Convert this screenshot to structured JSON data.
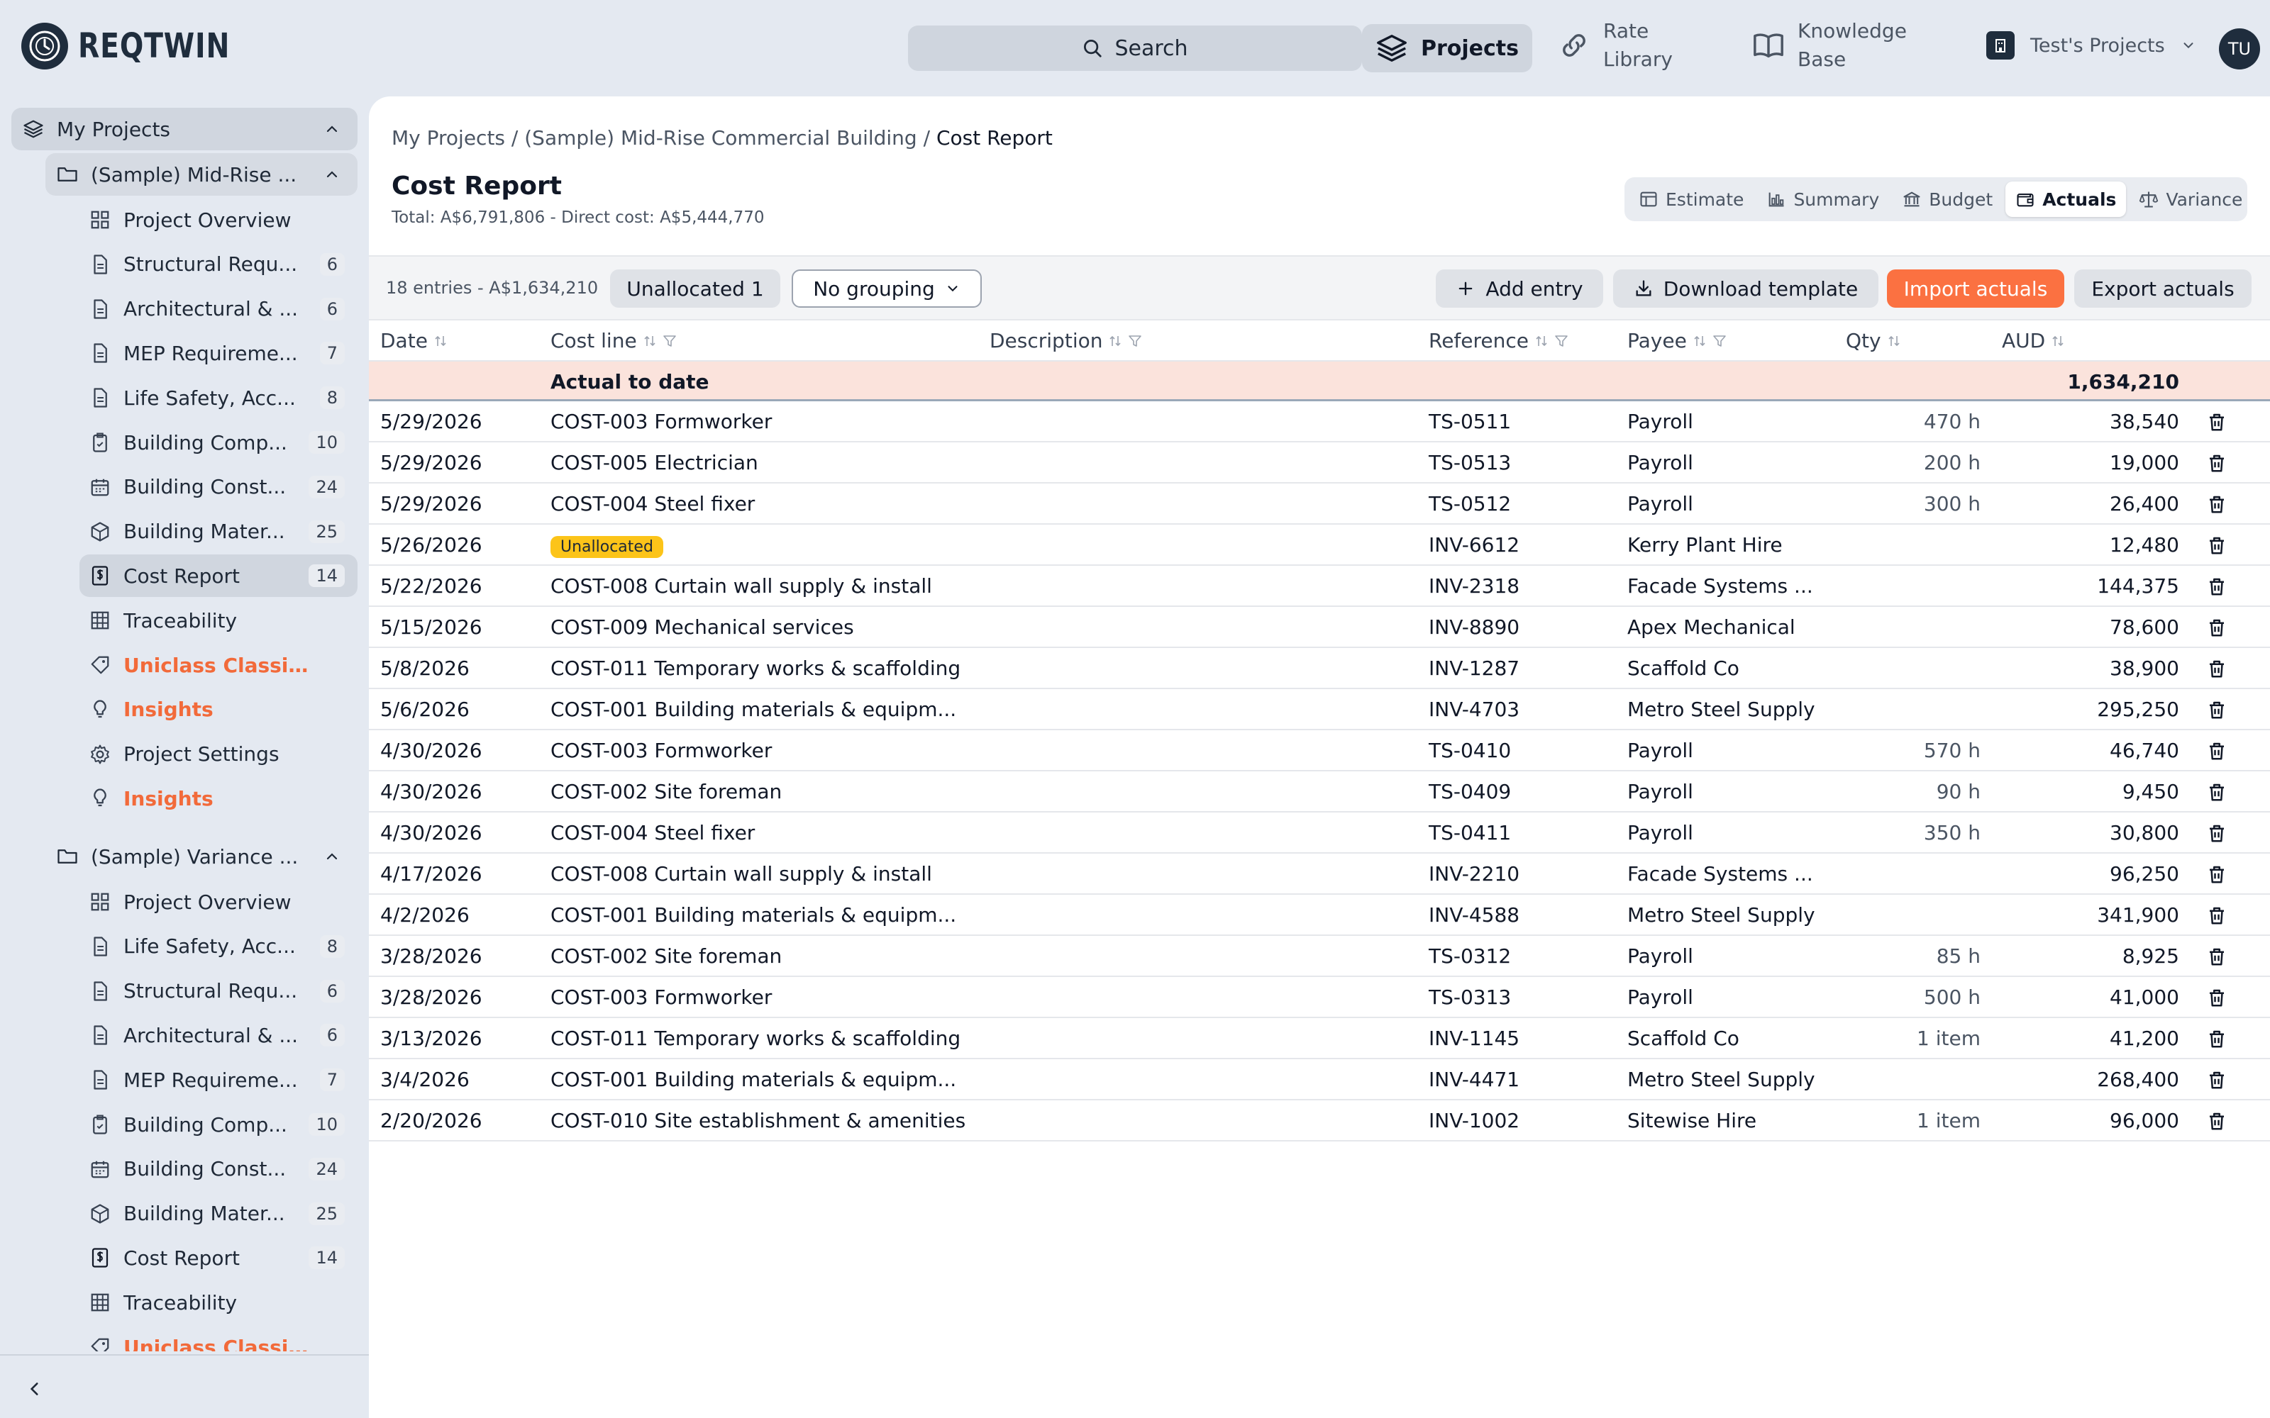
{
  "brand": {
    "name": "REQTWIN"
  },
  "topnav": {
    "search_label": "Search",
    "projects_label": "Projects",
    "rate_line1": "Rate",
    "rate_line2": "Library",
    "kb_line1": "Knowledge",
    "kb_line2": "Base",
    "org_label": "Test's Projects",
    "avatar_initials": "TU"
  },
  "sidebar": {
    "root_label": "My Projects",
    "project1": {
      "label": "(Sample) Mid-Rise ...",
      "items": [
        {
          "label": "Project Overview",
          "icon": "grid-icon",
          "count": ""
        },
        {
          "label": "Structural Requ...",
          "icon": "document-icon",
          "count": "6"
        },
        {
          "label": "Architectural & ...",
          "icon": "document-icon",
          "count": "6"
        },
        {
          "label": "MEP Requireme...",
          "icon": "document-icon",
          "count": "7"
        },
        {
          "label": "Life Safety, Acc...",
          "icon": "document-icon",
          "count": "8"
        },
        {
          "label": "Building Comp...",
          "icon": "clipboard-icon",
          "count": "10"
        },
        {
          "label": "Building Const...",
          "icon": "calendar-icon",
          "count": "24"
        },
        {
          "label": "Building Mater...",
          "icon": "box-icon",
          "count": "25"
        },
        {
          "label": "Cost Report",
          "icon": "dollar-doc-icon",
          "count": "14"
        },
        {
          "label": "Traceability",
          "icon": "table-icon",
          "count": ""
        },
        {
          "label": "Uniclass Classific...",
          "icon": "tag-icon",
          "count": ""
        },
        {
          "label": "Insights",
          "icon": "bulb-icon",
          "count": ""
        },
        {
          "label": "Project Settings",
          "icon": "gear-icon",
          "count": ""
        },
        {
          "label": "Insights",
          "icon": "bulb-icon",
          "count": ""
        }
      ]
    },
    "project2": {
      "label": "(Sample) Variance ...",
      "items": [
        {
          "label": "Project Overview",
          "icon": "grid-icon",
          "count": ""
        },
        {
          "label": "Life Safety, Acc...",
          "icon": "document-icon",
          "count": "8"
        },
        {
          "label": "Structural Requ...",
          "icon": "document-icon",
          "count": "6"
        },
        {
          "label": "Architectural & ...",
          "icon": "document-icon",
          "count": "6"
        },
        {
          "label": "MEP Requireme...",
          "icon": "document-icon",
          "count": "7"
        },
        {
          "label": "Building Comp...",
          "icon": "clipboard-icon",
          "count": "10"
        },
        {
          "label": "Building Const...",
          "icon": "calendar-icon",
          "count": "24"
        },
        {
          "label": "Building Mater...",
          "icon": "box-icon",
          "count": "25"
        },
        {
          "label": "Cost Report",
          "icon": "dollar-doc-icon",
          "count": "14"
        },
        {
          "label": "Traceability",
          "icon": "table-icon",
          "count": ""
        },
        {
          "label": "Uniclass Classific...",
          "icon": "tag-icon",
          "count": ""
        }
      ]
    }
  },
  "page": {
    "breadcrumb_1": "My Projects",
    "breadcrumb_sep": " / ",
    "breadcrumb_2": "(Sample) Mid-Rise Commercial Building",
    "breadcrumb_3": "Cost Report",
    "title": "Cost Report",
    "subtitle": "Total: A$6,791,806 - Direct cost: A$5,444,770",
    "tabs": [
      {
        "label": "Estimate",
        "icon": "table-icon"
      },
      {
        "label": "Summary",
        "icon": "bar-chart-icon"
      },
      {
        "label": "Budget",
        "icon": "bank-icon"
      },
      {
        "label": "Actuals",
        "icon": "wallet-icon"
      },
      {
        "label": "Variance",
        "icon": "scale-icon"
      }
    ],
    "active_tab": "Actuals"
  },
  "toolbar": {
    "entries_info": "18 entries - A$1,634,210",
    "unallocated_label": "Unallocated 1",
    "grouping_value": "No grouping",
    "add_label": "Add entry",
    "download_label": "Download template",
    "import_label": "Import actuals",
    "export_label": "Export actuals"
  },
  "table": {
    "headers": {
      "date": "Date",
      "cost_line": "Cost line",
      "description": "Description",
      "reference": "Reference",
      "payee": "Payee",
      "qty": "Qty",
      "aud": "AUD"
    },
    "total_label": "Actual to date",
    "total_amount": "1,634,210",
    "rows": [
      {
        "date": "5/29/2026",
        "cost": "COST-003 Formworker",
        "ref": "TS-0511",
        "payee": "Payroll",
        "qty": "470 h",
        "aud": "38,540"
      },
      {
        "date": "5/29/2026",
        "cost": "COST-005 Electrician",
        "ref": "TS-0513",
        "payee": "Payroll",
        "qty": "200 h",
        "aud": "19,000"
      },
      {
        "date": "5/29/2026",
        "cost": "COST-004 Steel fixer",
        "ref": "TS-0512",
        "payee": "Payroll",
        "qty": "300 h",
        "aud": "26,400"
      },
      {
        "date": "5/26/2026",
        "cost": "",
        "badge": "Unallocated",
        "ref": "INV-6612",
        "payee": "Kerry Plant Hire",
        "qty": "",
        "aud": "12,480"
      },
      {
        "date": "5/22/2026",
        "cost": "COST-008 Curtain wall supply & install",
        "ref": "INV-2318",
        "payee": "Facade Systems ...",
        "qty": "",
        "aud": "144,375"
      },
      {
        "date": "5/15/2026",
        "cost": "COST-009 Mechanical services",
        "ref": "INV-8890",
        "payee": "Apex Mechanical",
        "qty": "",
        "aud": "78,600"
      },
      {
        "date": "5/8/2026",
        "cost": "COST-011 Temporary works & scaffolding",
        "ref": "INV-1287",
        "payee": "Scaffold Co",
        "qty": "",
        "aud": "38,900"
      },
      {
        "date": "5/6/2026",
        "cost": "COST-001 Building materials & equipm...",
        "ref": "INV-4703",
        "payee": "Metro Steel Supply",
        "qty": "",
        "aud": "295,250"
      },
      {
        "date": "4/30/2026",
        "cost": "COST-003 Formworker",
        "ref": "TS-0410",
        "payee": "Payroll",
        "qty": "570 h",
        "aud": "46,740"
      },
      {
        "date": "4/30/2026",
        "cost": "COST-002 Site foreman",
        "ref": "TS-0409",
        "payee": "Payroll",
        "qty": "90 h",
        "aud": "9,450"
      },
      {
        "date": "4/30/2026",
        "cost": "COST-004 Steel fixer",
        "ref": "TS-0411",
        "payee": "Payroll",
        "qty": "350 h",
        "aud": "30,800"
      },
      {
        "date": "4/17/2026",
        "cost": "COST-008 Curtain wall supply & install",
        "ref": "INV-2210",
        "payee": "Facade Systems ...",
        "qty": "",
        "aud": "96,250"
      },
      {
        "date": "4/2/2026",
        "cost": "COST-001 Building materials & equipm...",
        "ref": "INV-4588",
        "payee": "Metro Steel Supply",
        "qty": "",
        "aud": "341,900"
      },
      {
        "date": "3/28/2026",
        "cost": "COST-002 Site foreman",
        "ref": "TS-0312",
        "payee": "Payroll",
        "qty": "85 h",
        "aud": "8,925"
      },
      {
        "date": "3/28/2026",
        "cost": "COST-003 Formworker",
        "ref": "TS-0313",
        "payee": "Payroll",
        "qty": "500 h",
        "aud": "41,000"
      },
      {
        "date": "3/13/2026",
        "cost": "COST-011 Temporary works & scaffolding",
        "ref": "INV-1145",
        "payee": "Scaffold Co",
        "qty": "1 item",
        "aud": "41,200"
      },
      {
        "date": "3/4/2026",
        "cost": "COST-001 Building materials & equipm...",
        "ref": "INV-4471",
        "payee": "Metro Steel Supply",
        "qty": "",
        "aud": "268,400"
      },
      {
        "date": "2/20/2026",
        "cost": "COST-010 Site establishment & amenities",
        "ref": "INV-1002",
        "payee": "Sitewise Hire",
        "qty": "1 item",
        "aud": "96,000"
      }
    ]
  },
  "colors": {
    "accent": "#fb7141",
    "nav_dark": "#1f2d3d",
    "total_row_bg": "#fbe3dc",
    "badge_yellow": "#fcc419"
  }
}
